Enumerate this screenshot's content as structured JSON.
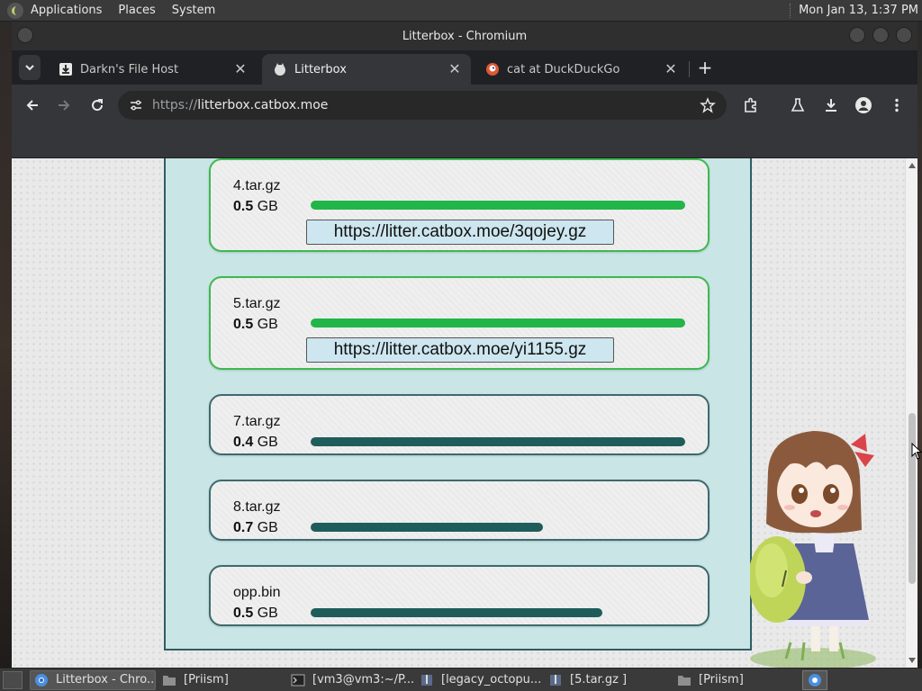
{
  "top_panel": {
    "menus": [
      "Applications",
      "Places",
      "System"
    ],
    "clock": "Mon Jan 13,  1:37 PM"
  },
  "window": {
    "title": "Litterbox - Chromium"
  },
  "tabs": [
    {
      "label": "Darkn's File Host",
      "icon": "download-icon",
      "active": false
    },
    {
      "label": "Litterbox",
      "icon": "litterbox-favicon",
      "active": true
    },
    {
      "label": "cat at DuckDuckGo",
      "icon": "duckduckgo-icon",
      "active": false
    }
  ],
  "omnibox": {
    "scheme": "https://",
    "host": "litterbox.catbox.moe"
  },
  "files": [
    {
      "name": "4.tar.gz",
      "size_value": "0.5",
      "size_unit": "GB",
      "progress": 1.0,
      "status": "done",
      "url": "https://litter.catbox.moe/3qojey.gz"
    },
    {
      "name": "5.tar.gz",
      "size_value": "0.5",
      "size_unit": "GB",
      "progress": 1.0,
      "status": "done",
      "url": "https://litter.catbox.moe/yi1155.gz"
    },
    {
      "name": "7.tar.gz",
      "size_value": "0.4",
      "size_unit": "GB",
      "progress": 1.0,
      "status": "uploading",
      "url": ""
    },
    {
      "name": "8.tar.gz",
      "size_value": "0.7",
      "size_unit": "GB",
      "progress": 0.62,
      "status": "uploading",
      "url": ""
    },
    {
      "name": "opp.bin",
      "size_value": "0.5",
      "size_unit": "GB",
      "progress": 0.78,
      "status": "uploading",
      "url": ""
    }
  ],
  "colors": {
    "done_bar": "#22b548",
    "uploading_bar": "#1e5d5a",
    "panel_bg": "#c9e5e6"
  },
  "taskbar": {
    "items": [
      {
        "label": "Litterbox - Chro...",
        "icon": "chromium-icon",
        "active": true
      },
      {
        "label": "[Priism]",
        "icon": "folder-icon",
        "active": false
      },
      {
        "label": "[vm3@vm3:~/P...",
        "icon": "terminal-icon",
        "active": false
      },
      {
        "label": "[legacy_octopu...",
        "icon": "archive-icon",
        "active": false
      },
      {
        "label": "[5.tar.gz ]",
        "icon": "archive-icon",
        "active": false
      },
      {
        "label": "[Priism]",
        "icon": "folder-icon",
        "active": false
      }
    ]
  }
}
